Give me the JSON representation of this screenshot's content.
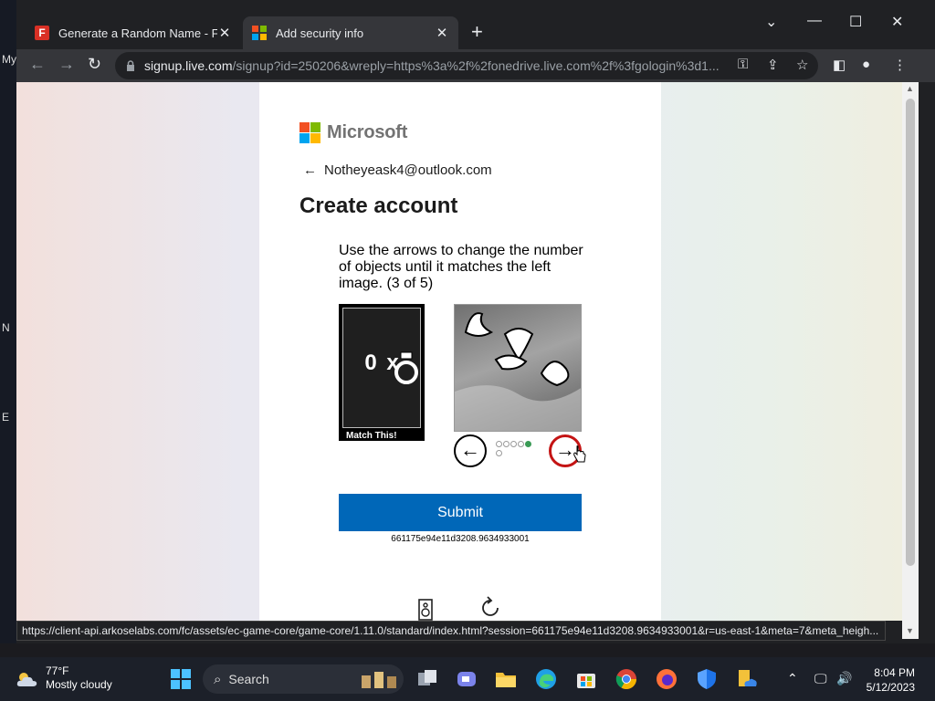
{
  "desktop": {
    "left_labels": [
      "My",
      "N",
      "E"
    ]
  },
  "browser": {
    "tabs": [
      {
        "title": "Generate a Random Name - Fake",
        "favicon": "fake-name-f-icon",
        "active": false
      },
      {
        "title": "Add security info",
        "favicon": "microsoft-icon",
        "active": true
      }
    ],
    "new_tab_label": "+",
    "url": {
      "host": "signup.live.com",
      "path": "/signup?id=250206&wreply=https%3a%2f%2fonedrive.live.com%2f%3fgologin%3d1..."
    },
    "status_bar": "https://client-api.arkoselabs.com/fc/assets/ec-game-core/game-core/1.11.0/standard/index.html?session=661175e94e11d3208.9634933001&r=us-east-1&meta=7&meta_heigh...",
    "scrollbar_fraction_visible": 0.84
  },
  "page": {
    "brand": "Microsoft",
    "email": "Notheyeask4@outlook.com",
    "heading": "Create account",
    "captcha": {
      "instructions": "Use the arrows to change the number of objects until it matches the left image. (3 of 5)",
      "match_text": "0 x",
      "match_caption": "Match This!",
      "current_object_count": 3,
      "selected_dot": 5,
      "dot_count": 6
    },
    "submit_label": "Submit",
    "session_id": "661175e94e11d3208.9634933001"
  },
  "taskbar": {
    "weather_temp": "77°F",
    "weather_desc": "Mostly cloudy",
    "search_label": "Search",
    "time": "8:04 PM",
    "date": "5/12/2023"
  },
  "colors": {
    "microsoft_red": "#f25022",
    "microsoft_green": "#7fba00",
    "microsoft_blue": "#00a4ef",
    "microsoft_yellow": "#ffb900",
    "submit_blue": "#0067b8",
    "next_arrow_red": "#c41414",
    "dot_green": "#3a9a55"
  }
}
